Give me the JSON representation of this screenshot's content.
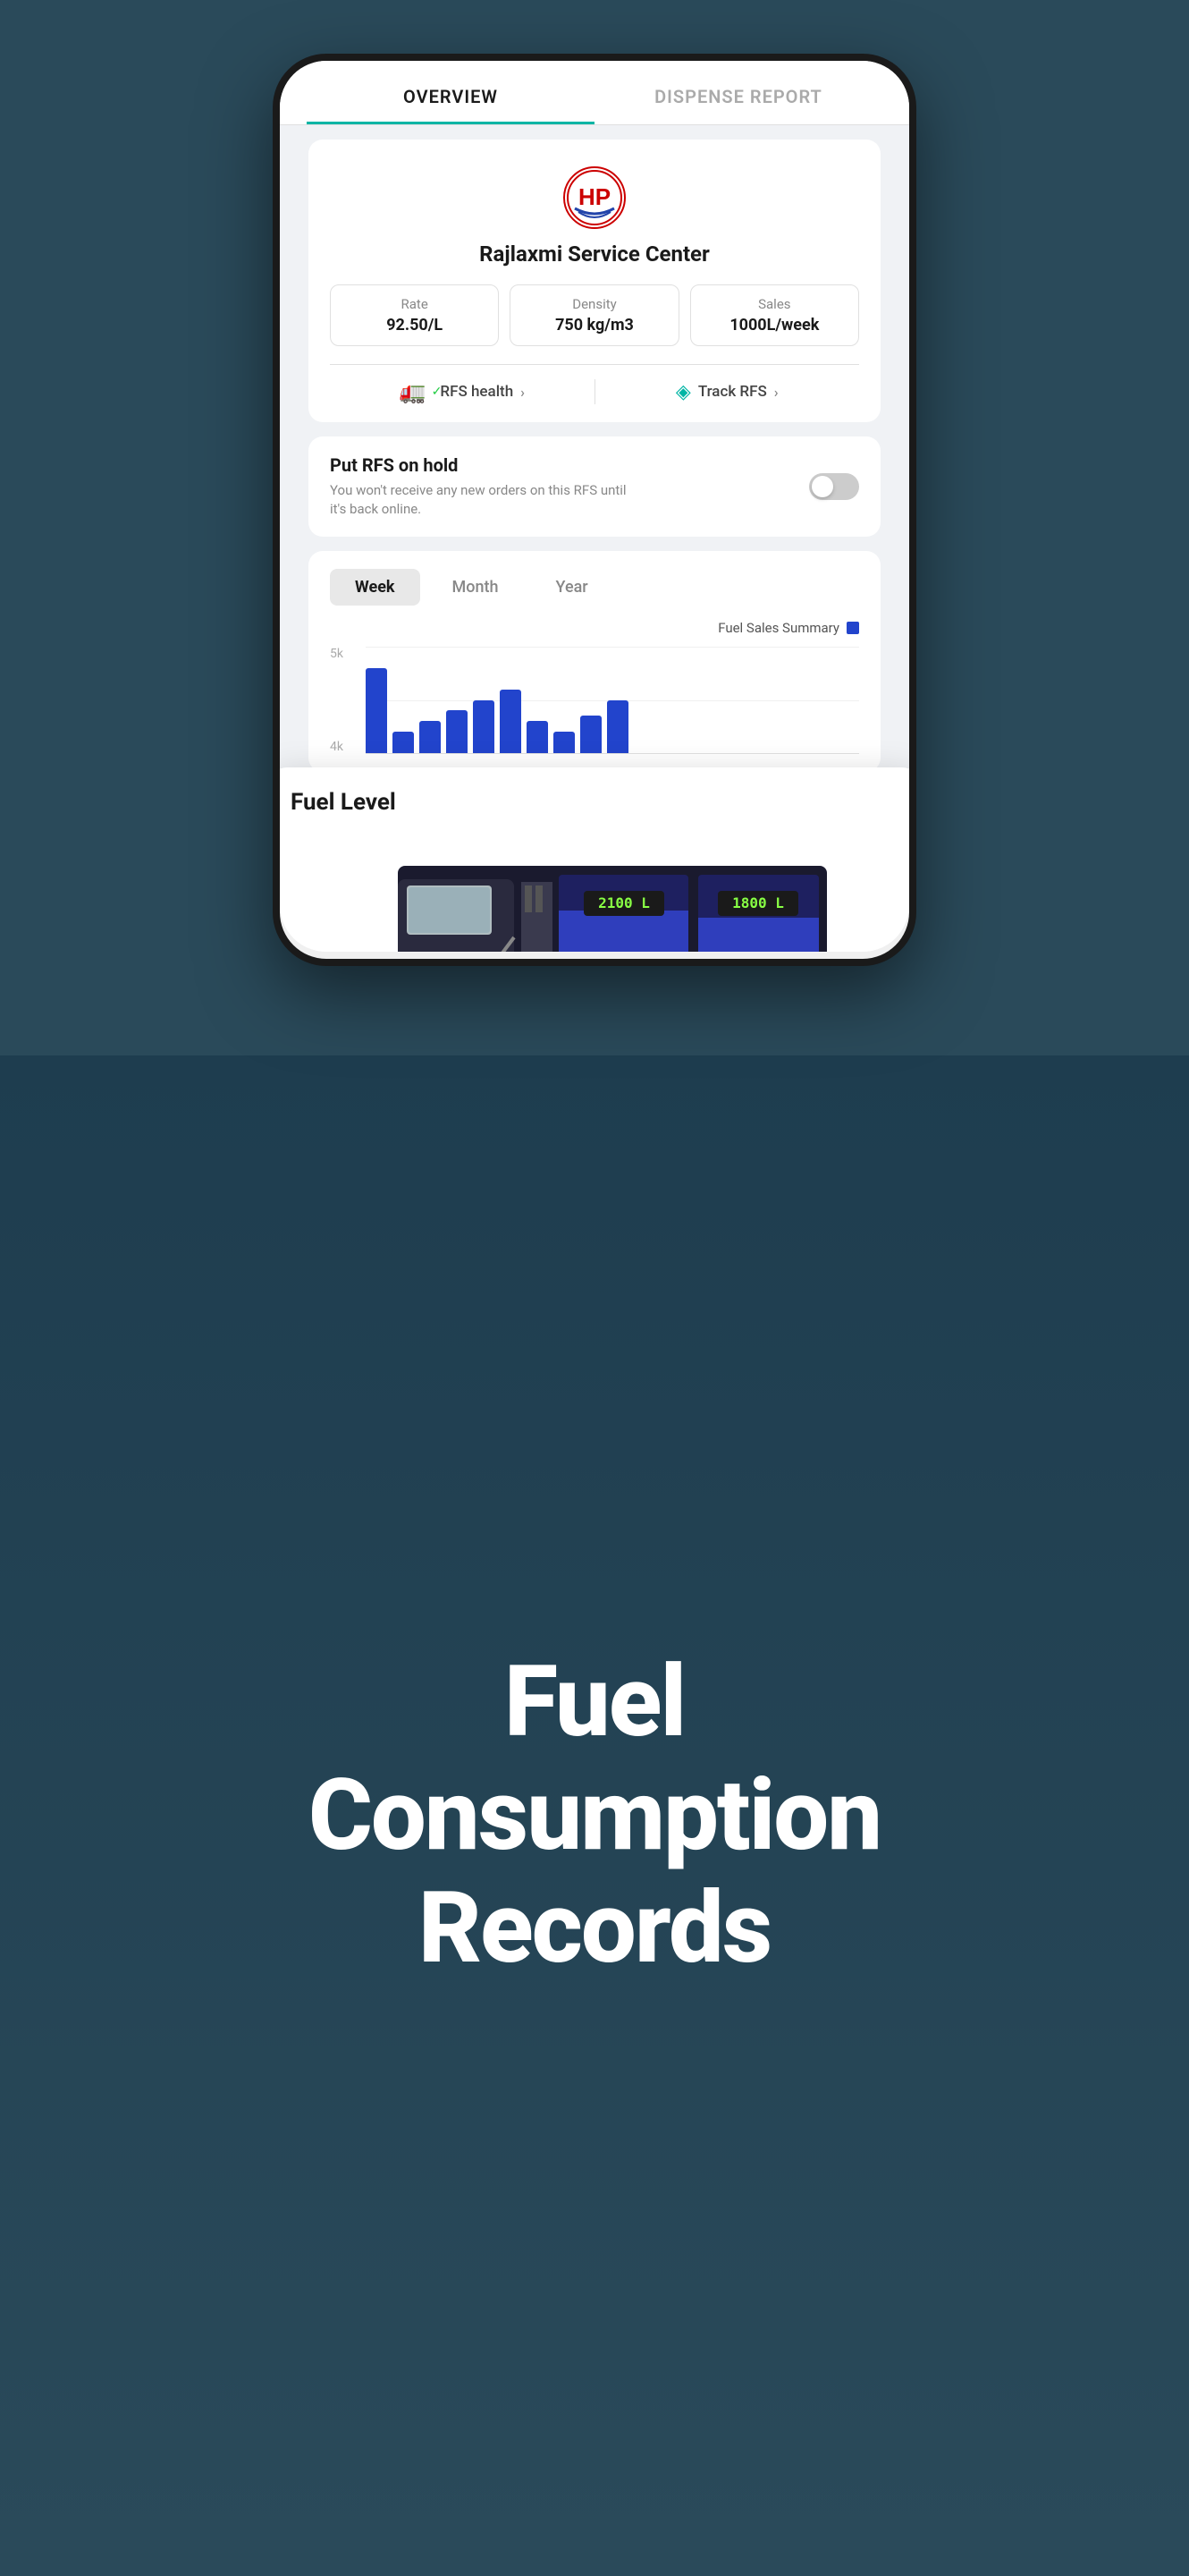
{
  "tabs": {
    "overview": "OVERVIEW",
    "dispense_report": "DISPENSE REPORT"
  },
  "service_center": {
    "name": "Rajlaxmi Service Center",
    "rate_label": "Rate",
    "rate_value": "92.50/L",
    "density_label": "Density",
    "density_value": "750 kg/m3",
    "sales_label": "Sales",
    "sales_value": "1000L/week"
  },
  "actions": {
    "rfs_health": "RFS health",
    "track_rfs": "Track RFS"
  },
  "fuel_level": {
    "title": "Fuel Level",
    "tank1": "2100 L",
    "tank2": "1800 L"
  },
  "rfs_hold": {
    "title": "Put RFS on hold",
    "description": "You won't receive any new orders on this RFS until it's back online."
  },
  "chart": {
    "week_label": "Week",
    "month_label": "Month",
    "year_label": "Year",
    "legend_label": "Fuel Sales Summary",
    "y_labels": [
      "5k",
      "4k"
    ],
    "bars": [
      0.8,
      0.2,
      0.3,
      0.4,
      0.5,
      0.6,
      0.3,
      0.2,
      0.35,
      0.5
    ]
  },
  "headline": {
    "line1": "Fuel",
    "line2": "Consumption",
    "line3": "Records"
  }
}
